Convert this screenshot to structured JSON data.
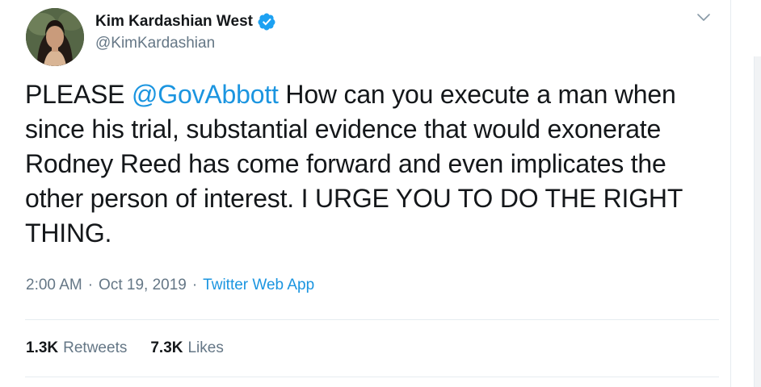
{
  "author": {
    "display_name": "Kim Kardashian West",
    "handle": "@KimKardashian",
    "verified": true,
    "avatar_icon": "profile-photo"
  },
  "tweet": {
    "text_before": "PLEASE ",
    "mention": "@GovAbbott",
    "text_after": " How can you execute a man when since his trial, substantial evidence that would exonerate Rodney Reed has come forward and even implicates the other person of interest. I URGE YOU TO DO THE RIGHT THING."
  },
  "meta": {
    "time": "2:00 AM",
    "separator": "·",
    "date": "Oct 19, 2019",
    "source": "Twitter Web App"
  },
  "stats": {
    "retweets_count": "1.3K",
    "retweets_label": "Retweets",
    "likes_count": "7.3K",
    "likes_label": "Likes"
  },
  "colors": {
    "accent": "#1b95e0",
    "secondary_text": "#657786",
    "primary_text": "#14171a",
    "verified_badge": "#1da1f2",
    "divider": "#e6ecf0"
  }
}
